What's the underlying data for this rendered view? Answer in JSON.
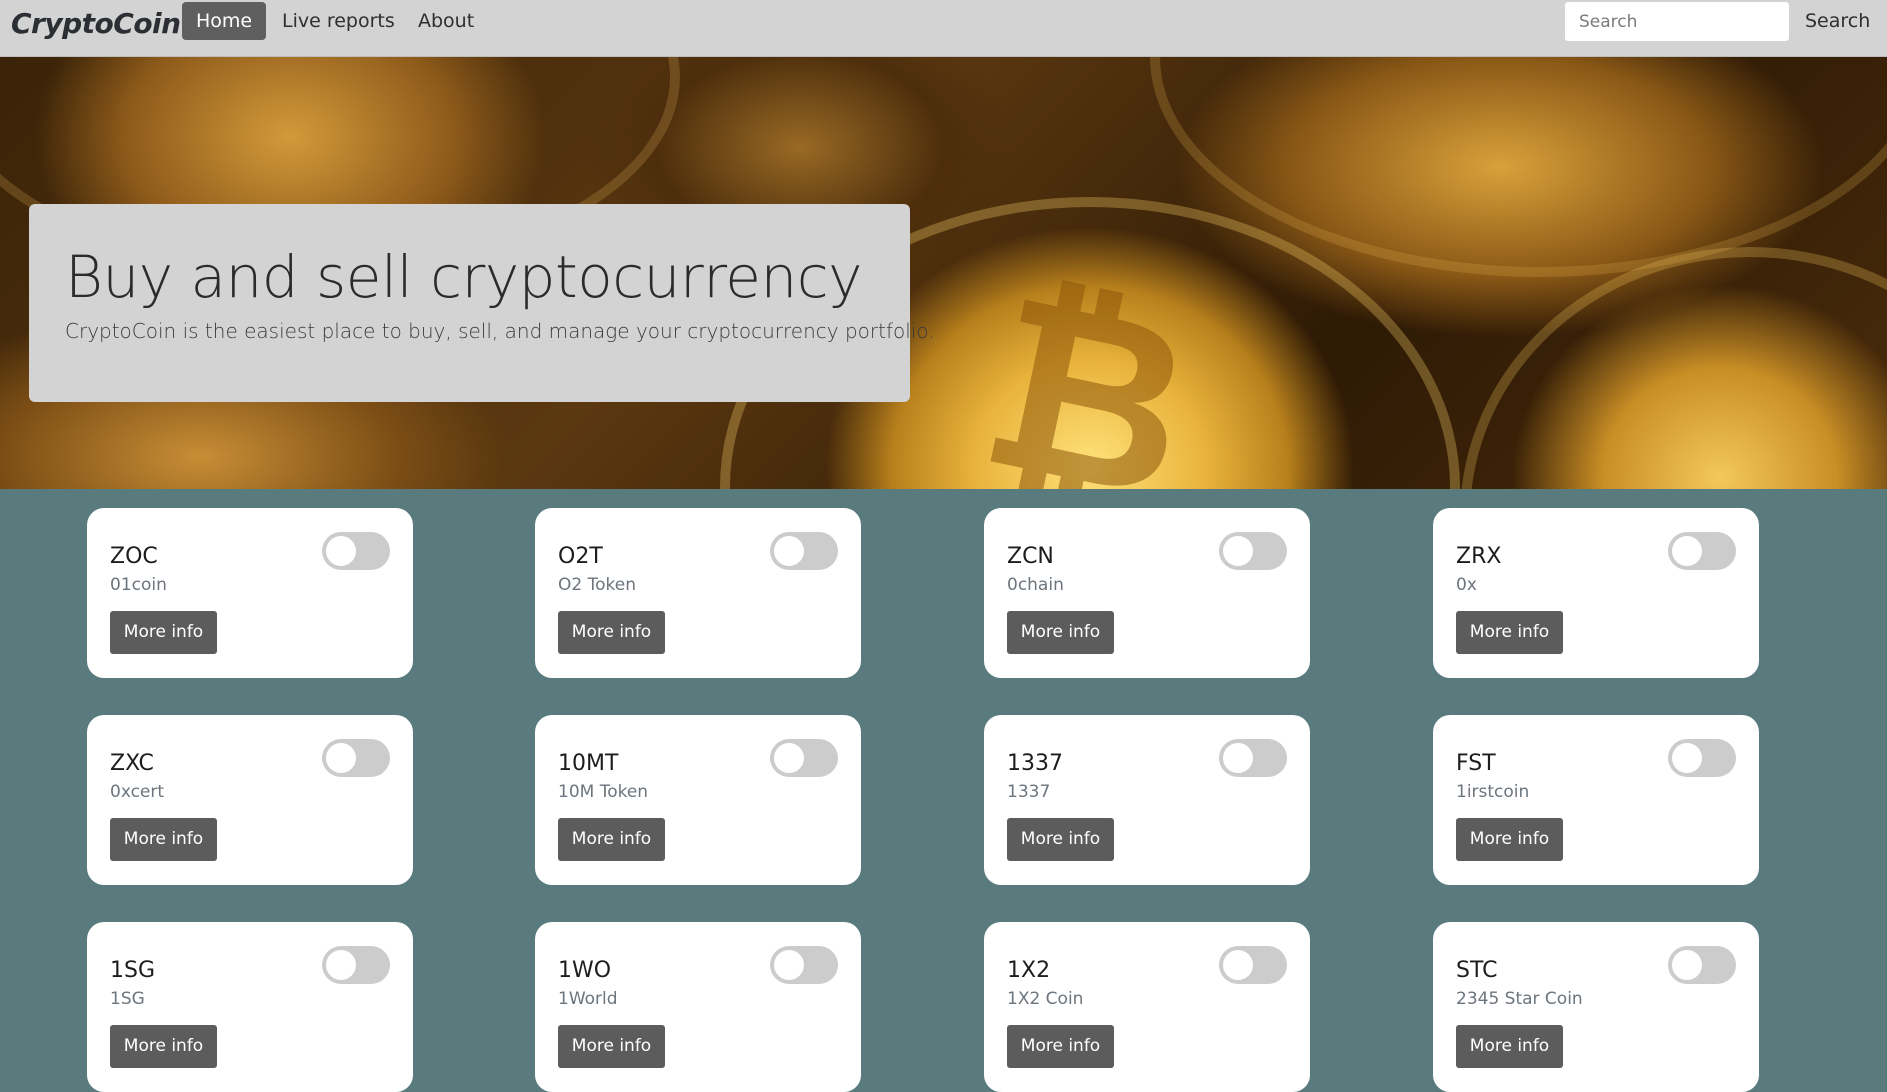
{
  "navbar": {
    "brand": "CryptoCoin",
    "links": [
      {
        "label": "Home",
        "active": true
      },
      {
        "label": "Live reports",
        "active": false
      },
      {
        "label": "About",
        "active": false
      }
    ],
    "search_placeholder": "Search",
    "search_button": "Search"
  },
  "hero": {
    "title": "Buy and sell cryptocurrency",
    "subtitle": "CryptoCoin is the easiest place to buy, sell, and manage your cryptocurrency portfolio."
  },
  "coins": [
    {
      "symbol": "ZOC",
      "name": "01coin",
      "button": "More info",
      "toggled": false
    },
    {
      "symbol": "O2T",
      "name": "O2 Token",
      "button": "More info",
      "toggled": false
    },
    {
      "symbol": "ZCN",
      "name": "0chain",
      "button": "More info",
      "toggled": false
    },
    {
      "symbol": "ZRX",
      "name": "0x",
      "button": "More info",
      "toggled": false
    },
    {
      "symbol": "ZXC",
      "name": "0xcert",
      "button": "More info",
      "toggled": false
    },
    {
      "symbol": "10MT",
      "name": "10M Token",
      "button": "More info",
      "toggled": false
    },
    {
      "symbol": "1337",
      "name": "1337",
      "button": "More info",
      "toggled": false
    },
    {
      "symbol": "FST",
      "name": "1irstcoin",
      "button": "More info",
      "toggled": false
    },
    {
      "symbol": "1SG",
      "name": "1SG",
      "button": "More info",
      "toggled": false
    },
    {
      "symbol": "1WO",
      "name": "1World",
      "button": "More info",
      "toggled": false
    },
    {
      "symbol": "1X2",
      "name": "1X2 Coin",
      "button": "More info",
      "toggled": false
    },
    {
      "symbol": "STC",
      "name": "2345 Star Coin",
      "button": "More info",
      "toggled": false
    }
  ],
  "colors": {
    "navbar_bg": "#d3d3d3",
    "active_link_bg": "#5f5f5f",
    "page_bg": "#5a7b7e",
    "button_bg": "#5c5c5c",
    "toggle_off": "#cccccc"
  }
}
